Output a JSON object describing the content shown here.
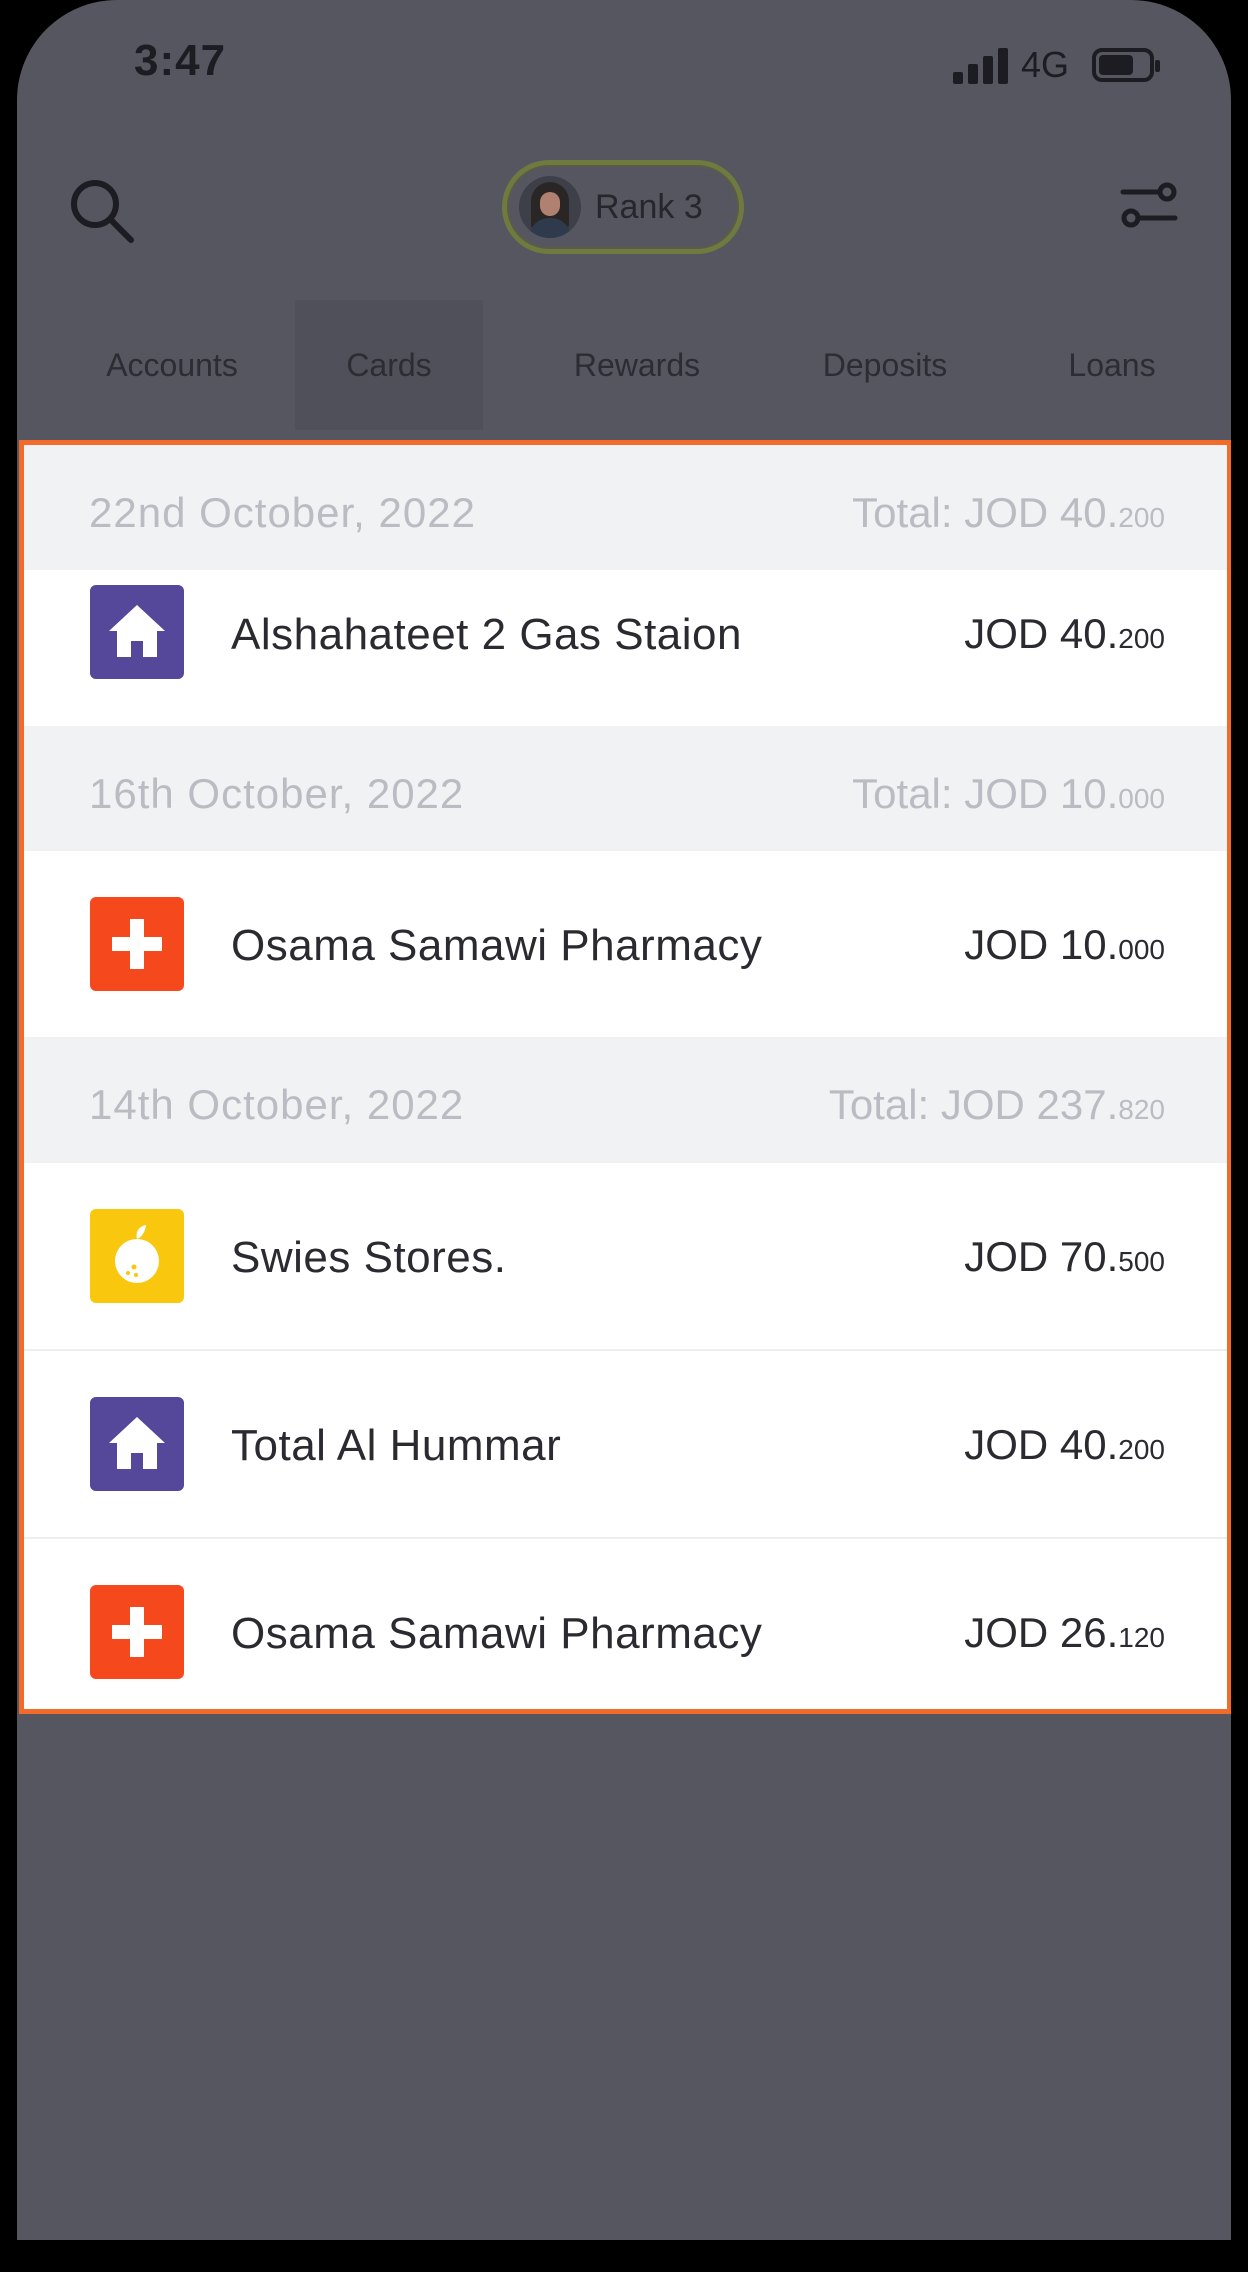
{
  "status": {
    "time": "3:47",
    "network": "4G"
  },
  "header": {
    "rank_label": "Rank 3"
  },
  "tabs": [
    {
      "label": "Accounts"
    },
    {
      "label": "Cards"
    },
    {
      "label": "Rewards"
    },
    {
      "label": "Deposits"
    },
    {
      "label": "Loans"
    }
  ],
  "active_tab": "Cards",
  "groups": [
    {
      "date": "22nd October, 2022",
      "total_int": "Total: JOD 40.",
      "total_dec": "200",
      "transactions": [
        {
          "name": "Alshahateet 2 Gas Staion",
          "amount_int": "JOD 40.",
          "amount_dec": "200",
          "icon": "house-icon",
          "color": "#55479a"
        }
      ]
    },
    {
      "date": "16th October, 2022",
      "total_int": "Total: JOD 10.",
      "total_dec": "000",
      "transactions": [
        {
          "name": "Osama Samawi Pharmacy",
          "amount_int": "JOD 10.",
          "amount_dec": "000",
          "icon": "medical-cross-icon",
          "color": "#f5481c"
        }
      ]
    },
    {
      "date": "14th October, 2022",
      "total_int": "Total: JOD 237.",
      "total_dec": "820",
      "transactions": [
        {
          "name": "Swies Stores.",
          "amount_int": "JOD 70.",
          "amount_dec": "500",
          "icon": "lemon-icon",
          "color": "#f9c80e"
        },
        {
          "name": "Total Al Hummar",
          "amount_int": "JOD 40.",
          "amount_dec": "200",
          "icon": "house-icon",
          "color": "#55479a"
        },
        {
          "name": "Osama Samawi Pharmacy",
          "amount_int": "JOD 26.",
          "amount_dec": "120",
          "icon": "medical-cross-icon",
          "color": "#f5481c"
        }
      ]
    }
  ],
  "colors": {
    "highlight_border": "#f26b2a",
    "overlay": "#555660",
    "date_text": "#b9bcc2"
  }
}
